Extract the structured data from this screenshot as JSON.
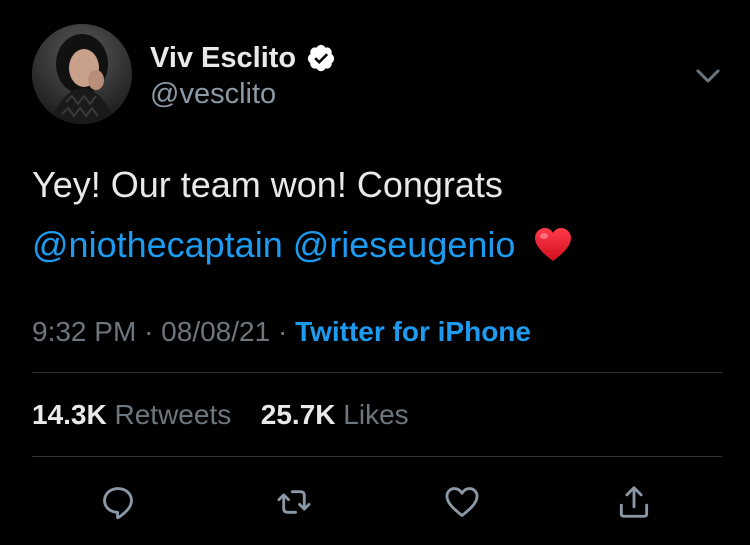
{
  "user": {
    "display_name": "Viv Esclito",
    "handle": "@vesclito"
  },
  "tweet": {
    "text_line1": "Yey! Our team won! Congrats",
    "mentions": [
      "@niothecaptain",
      "@rieseugenio"
    ],
    "emoji": "red-heart"
  },
  "meta": {
    "time": "9:32 PM",
    "sep1": "·",
    "date": "08/08/21",
    "sep2": "·",
    "source": "Twitter for iPhone"
  },
  "stats": {
    "retweets_count": "14.3K",
    "retweets_label": "Retweets",
    "likes_count": "25.7K",
    "likes_label": "Likes"
  },
  "icons": {
    "verified": "verified-badge-icon",
    "more": "chevron-down-icon",
    "reply": "reply-icon",
    "retweet": "retweet-icon",
    "like": "like-heart-icon",
    "share": "share-icon"
  },
  "colors": {
    "background": "#000000",
    "link": "#1d9bf0",
    "muted": "#6e767d",
    "text": "#e7e9ea"
  }
}
